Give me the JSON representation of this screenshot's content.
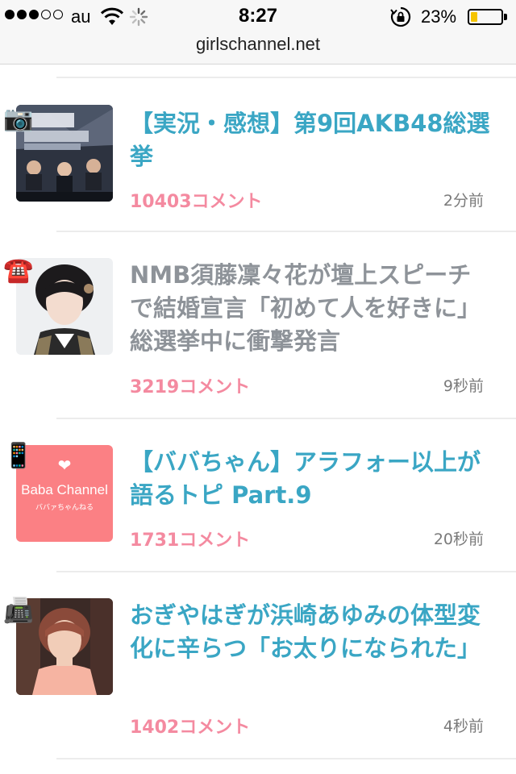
{
  "status_bar": {
    "carrier": "au",
    "time": "8:27",
    "battery_percent": "23%",
    "battery_level": 0.23,
    "signal_bars_filled": 3,
    "signal_bars_total": 5
  },
  "url_bar": {
    "domain": "girlschannel.net"
  },
  "colors": {
    "title_unread": "#3aa6c4",
    "title_read": "#8e9399",
    "comment_count": "#f48aa0",
    "battery_fill": "#f5c400"
  },
  "topics": [
    {
      "category_icon": "camera-icon",
      "thumbnail": "akb48-poster-thumbnail",
      "title": "【実況・感想】第9回AKB48総選挙",
      "comments": "10403コメント",
      "time": "2分前",
      "read": false
    },
    {
      "category_icon": "telephone-icon",
      "thumbnail": "portrait-thumbnail",
      "title": "NMB須藤凜々花が壇上スピーチで結婚宣言「初めて人を好きに」総選挙中に衝撃発言",
      "comments": "3219コメント",
      "time": "9秒前",
      "read": true
    },
    {
      "category_icon": "mobile-phone-icon",
      "thumbnail": "baba-channel-thumbnail",
      "thumbnail_text": {
        "heart": "❤",
        "brand": "Baba Channel",
        "sub": "ババァちゃんねる"
      },
      "title": "【ババちゃん】アラフォー以上が語るトピ Part.9",
      "comments": "1731コメント",
      "time": "20秒前",
      "read": false
    },
    {
      "category_icon": "fax-icon",
      "thumbnail": "woman-portrait-thumbnail",
      "title": "おぎやはぎが浜崎あゆみの体型変化に辛らつ「お太りになられた」",
      "comments": "1402コメント",
      "time": "4秒前",
      "read": false
    }
  ]
}
